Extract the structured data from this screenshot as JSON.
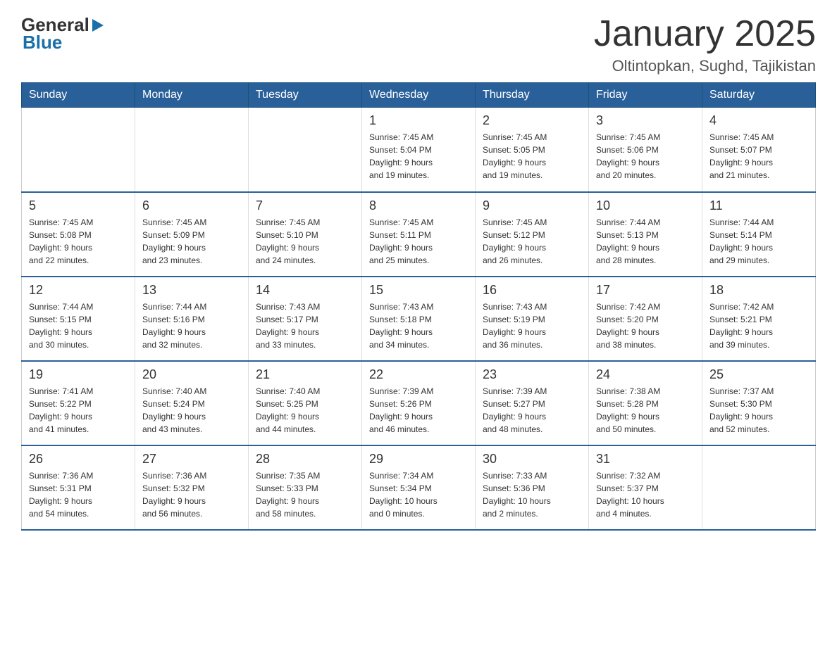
{
  "header": {
    "title": "January 2025",
    "subtitle": "Oltintopkan, Sughd, Tajikistan",
    "logo_general": "General",
    "logo_blue": "Blue"
  },
  "days_of_week": [
    "Sunday",
    "Monday",
    "Tuesday",
    "Wednesday",
    "Thursday",
    "Friday",
    "Saturday"
  ],
  "weeks": [
    [
      {
        "day": "",
        "info": ""
      },
      {
        "day": "",
        "info": ""
      },
      {
        "day": "",
        "info": ""
      },
      {
        "day": "1",
        "info": "Sunrise: 7:45 AM\nSunset: 5:04 PM\nDaylight: 9 hours\nand 19 minutes."
      },
      {
        "day": "2",
        "info": "Sunrise: 7:45 AM\nSunset: 5:05 PM\nDaylight: 9 hours\nand 19 minutes."
      },
      {
        "day": "3",
        "info": "Sunrise: 7:45 AM\nSunset: 5:06 PM\nDaylight: 9 hours\nand 20 minutes."
      },
      {
        "day": "4",
        "info": "Sunrise: 7:45 AM\nSunset: 5:07 PM\nDaylight: 9 hours\nand 21 minutes."
      }
    ],
    [
      {
        "day": "5",
        "info": "Sunrise: 7:45 AM\nSunset: 5:08 PM\nDaylight: 9 hours\nand 22 minutes."
      },
      {
        "day": "6",
        "info": "Sunrise: 7:45 AM\nSunset: 5:09 PM\nDaylight: 9 hours\nand 23 minutes."
      },
      {
        "day": "7",
        "info": "Sunrise: 7:45 AM\nSunset: 5:10 PM\nDaylight: 9 hours\nand 24 minutes."
      },
      {
        "day": "8",
        "info": "Sunrise: 7:45 AM\nSunset: 5:11 PM\nDaylight: 9 hours\nand 25 minutes."
      },
      {
        "day": "9",
        "info": "Sunrise: 7:45 AM\nSunset: 5:12 PM\nDaylight: 9 hours\nand 26 minutes."
      },
      {
        "day": "10",
        "info": "Sunrise: 7:44 AM\nSunset: 5:13 PM\nDaylight: 9 hours\nand 28 minutes."
      },
      {
        "day": "11",
        "info": "Sunrise: 7:44 AM\nSunset: 5:14 PM\nDaylight: 9 hours\nand 29 minutes."
      }
    ],
    [
      {
        "day": "12",
        "info": "Sunrise: 7:44 AM\nSunset: 5:15 PM\nDaylight: 9 hours\nand 30 minutes."
      },
      {
        "day": "13",
        "info": "Sunrise: 7:44 AM\nSunset: 5:16 PM\nDaylight: 9 hours\nand 32 minutes."
      },
      {
        "day": "14",
        "info": "Sunrise: 7:43 AM\nSunset: 5:17 PM\nDaylight: 9 hours\nand 33 minutes."
      },
      {
        "day": "15",
        "info": "Sunrise: 7:43 AM\nSunset: 5:18 PM\nDaylight: 9 hours\nand 34 minutes."
      },
      {
        "day": "16",
        "info": "Sunrise: 7:43 AM\nSunset: 5:19 PM\nDaylight: 9 hours\nand 36 minutes."
      },
      {
        "day": "17",
        "info": "Sunrise: 7:42 AM\nSunset: 5:20 PM\nDaylight: 9 hours\nand 38 minutes."
      },
      {
        "day": "18",
        "info": "Sunrise: 7:42 AM\nSunset: 5:21 PM\nDaylight: 9 hours\nand 39 minutes."
      }
    ],
    [
      {
        "day": "19",
        "info": "Sunrise: 7:41 AM\nSunset: 5:22 PM\nDaylight: 9 hours\nand 41 minutes."
      },
      {
        "day": "20",
        "info": "Sunrise: 7:40 AM\nSunset: 5:24 PM\nDaylight: 9 hours\nand 43 minutes."
      },
      {
        "day": "21",
        "info": "Sunrise: 7:40 AM\nSunset: 5:25 PM\nDaylight: 9 hours\nand 44 minutes."
      },
      {
        "day": "22",
        "info": "Sunrise: 7:39 AM\nSunset: 5:26 PM\nDaylight: 9 hours\nand 46 minutes."
      },
      {
        "day": "23",
        "info": "Sunrise: 7:39 AM\nSunset: 5:27 PM\nDaylight: 9 hours\nand 48 minutes."
      },
      {
        "day": "24",
        "info": "Sunrise: 7:38 AM\nSunset: 5:28 PM\nDaylight: 9 hours\nand 50 minutes."
      },
      {
        "day": "25",
        "info": "Sunrise: 7:37 AM\nSunset: 5:30 PM\nDaylight: 9 hours\nand 52 minutes."
      }
    ],
    [
      {
        "day": "26",
        "info": "Sunrise: 7:36 AM\nSunset: 5:31 PM\nDaylight: 9 hours\nand 54 minutes."
      },
      {
        "day": "27",
        "info": "Sunrise: 7:36 AM\nSunset: 5:32 PM\nDaylight: 9 hours\nand 56 minutes."
      },
      {
        "day": "28",
        "info": "Sunrise: 7:35 AM\nSunset: 5:33 PM\nDaylight: 9 hours\nand 58 minutes."
      },
      {
        "day": "29",
        "info": "Sunrise: 7:34 AM\nSunset: 5:34 PM\nDaylight: 10 hours\nand 0 minutes."
      },
      {
        "day": "30",
        "info": "Sunrise: 7:33 AM\nSunset: 5:36 PM\nDaylight: 10 hours\nand 2 minutes."
      },
      {
        "day": "31",
        "info": "Sunrise: 7:32 AM\nSunset: 5:37 PM\nDaylight: 10 hours\nand 4 minutes."
      },
      {
        "day": "",
        "info": ""
      }
    ]
  ]
}
